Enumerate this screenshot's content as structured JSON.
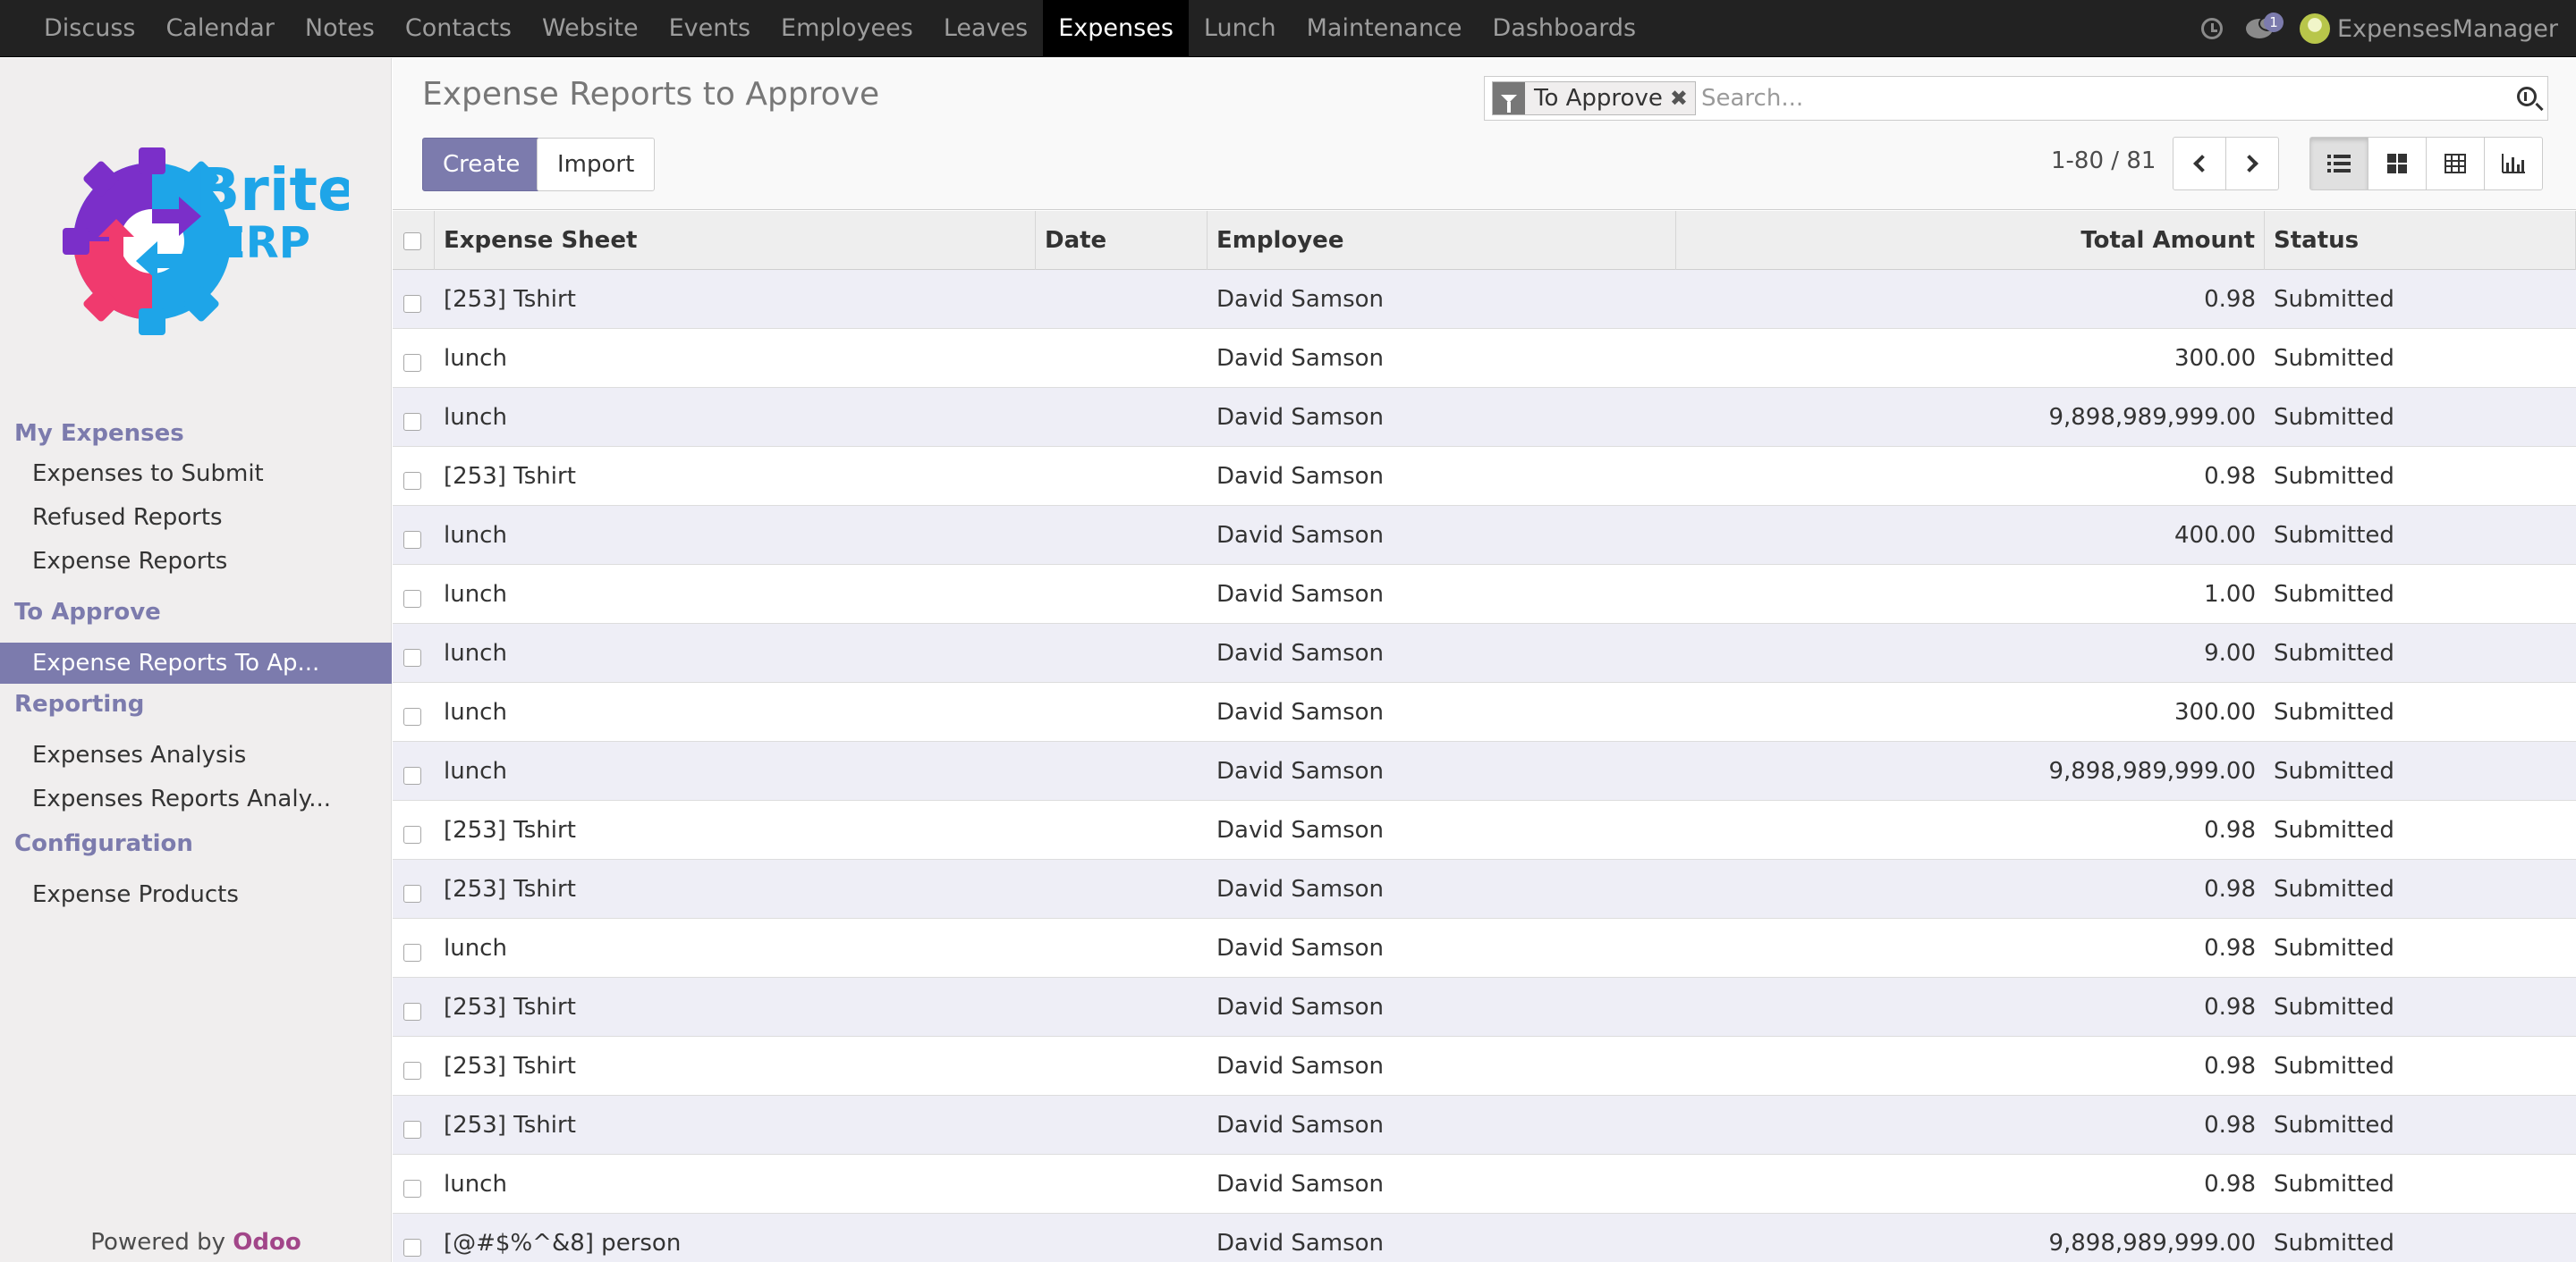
{
  "topbar": {
    "apps": [
      "Discuss",
      "Calendar",
      "Notes",
      "Contacts",
      "Website",
      "Events",
      "Employees",
      "Leaves",
      "Expenses",
      "Lunch",
      "Maintenance",
      "Dashboards"
    ],
    "active_app": "Expenses",
    "messages_count": "1",
    "user_name": "ExpensesManager"
  },
  "sidebar": {
    "logo_text": {
      "top": "Brite",
      "bottom": "ERP"
    },
    "sections": [
      {
        "heading": "My Expenses",
        "items": [
          "Expenses to Submit",
          "Refused Reports",
          "Expense Reports"
        ]
      },
      {
        "heading": "To Approve",
        "items": [
          "Expense Reports To Ap..."
        ]
      },
      {
        "heading": "Reporting",
        "items": [
          "Expenses Analysis",
          "Expenses Reports Analy..."
        ]
      },
      {
        "heading": "Configuration",
        "items": [
          "Expense Products"
        ]
      }
    ],
    "active_item": "Expense Reports To Ap...",
    "powered_prefix": "Powered by ",
    "powered_brand": "Odoo"
  },
  "control": {
    "title": "Expense Reports to Approve",
    "create_label": "Create",
    "import_label": "Import",
    "facet_label": "To Approve",
    "search_placeholder": "Search...",
    "pager_value": "1-80",
    "pager_sep": " / ",
    "pager_limit": "81",
    "active_view": "list"
  },
  "table": {
    "columns": [
      "Expense Sheet",
      "Date",
      "Employee",
      "Total Amount",
      "Status"
    ],
    "rows": [
      {
        "sheet": "[253] Tshirt",
        "date": "",
        "employee": "David Samson",
        "total": "0.98",
        "status": "Submitted"
      },
      {
        "sheet": "lunch",
        "date": "",
        "employee": "David Samson",
        "total": "300.00",
        "status": "Submitted"
      },
      {
        "sheet": "lunch",
        "date": "",
        "employee": "David Samson",
        "total": "9,898,989,999.00",
        "status": "Submitted"
      },
      {
        "sheet": "[253] Tshirt",
        "date": "",
        "employee": "David Samson",
        "total": "0.98",
        "status": "Submitted"
      },
      {
        "sheet": "lunch",
        "date": "",
        "employee": "David Samson",
        "total": "400.00",
        "status": "Submitted"
      },
      {
        "sheet": "lunch",
        "date": "",
        "employee": "David Samson",
        "total": "1.00",
        "status": "Submitted"
      },
      {
        "sheet": "lunch",
        "date": "",
        "employee": "David Samson",
        "total": "9.00",
        "status": "Submitted"
      },
      {
        "sheet": "lunch",
        "date": "",
        "employee": "David Samson",
        "total": "300.00",
        "status": "Submitted"
      },
      {
        "sheet": "lunch",
        "date": "",
        "employee": "David Samson",
        "total": "9,898,989,999.00",
        "status": "Submitted"
      },
      {
        "sheet": "[253] Tshirt",
        "date": "",
        "employee": "David Samson",
        "total": "0.98",
        "status": "Submitted"
      },
      {
        "sheet": "[253] Tshirt",
        "date": "",
        "employee": "David Samson",
        "total": "0.98",
        "status": "Submitted"
      },
      {
        "sheet": "lunch",
        "date": "",
        "employee": "David Samson",
        "total": "0.98",
        "status": "Submitted"
      },
      {
        "sheet": "[253] Tshirt",
        "date": "",
        "employee": "David Samson",
        "total": "0.98",
        "status": "Submitted"
      },
      {
        "sheet": "[253] Tshirt",
        "date": "",
        "employee": "David Samson",
        "total": "0.98",
        "status": "Submitted"
      },
      {
        "sheet": "[253] Tshirt",
        "date": "",
        "employee": "David Samson",
        "total": "0.98",
        "status": "Submitted"
      },
      {
        "sheet": "lunch",
        "date": "",
        "employee": "David Samson",
        "total": "0.98",
        "status": "Submitted"
      },
      {
        "sheet": "[@#$%^&8] person",
        "date": "",
        "employee": "David Samson",
        "total": "9,898,989,999.00",
        "status": "Submitted"
      }
    ]
  },
  "colors": {
    "accent": "#7c7bad",
    "topbar": "#222222",
    "brand_odoo": "#a24689",
    "logo_blue": "#1ea5e8",
    "logo_purple": "#7b2fc9",
    "logo_pink": "#f03a6e"
  },
  "icons": {
    "clock": "activity-clock-icon",
    "chat": "messages-icon",
    "filter": "filter-funnel-icon",
    "search": "search-magnifier-icon"
  }
}
